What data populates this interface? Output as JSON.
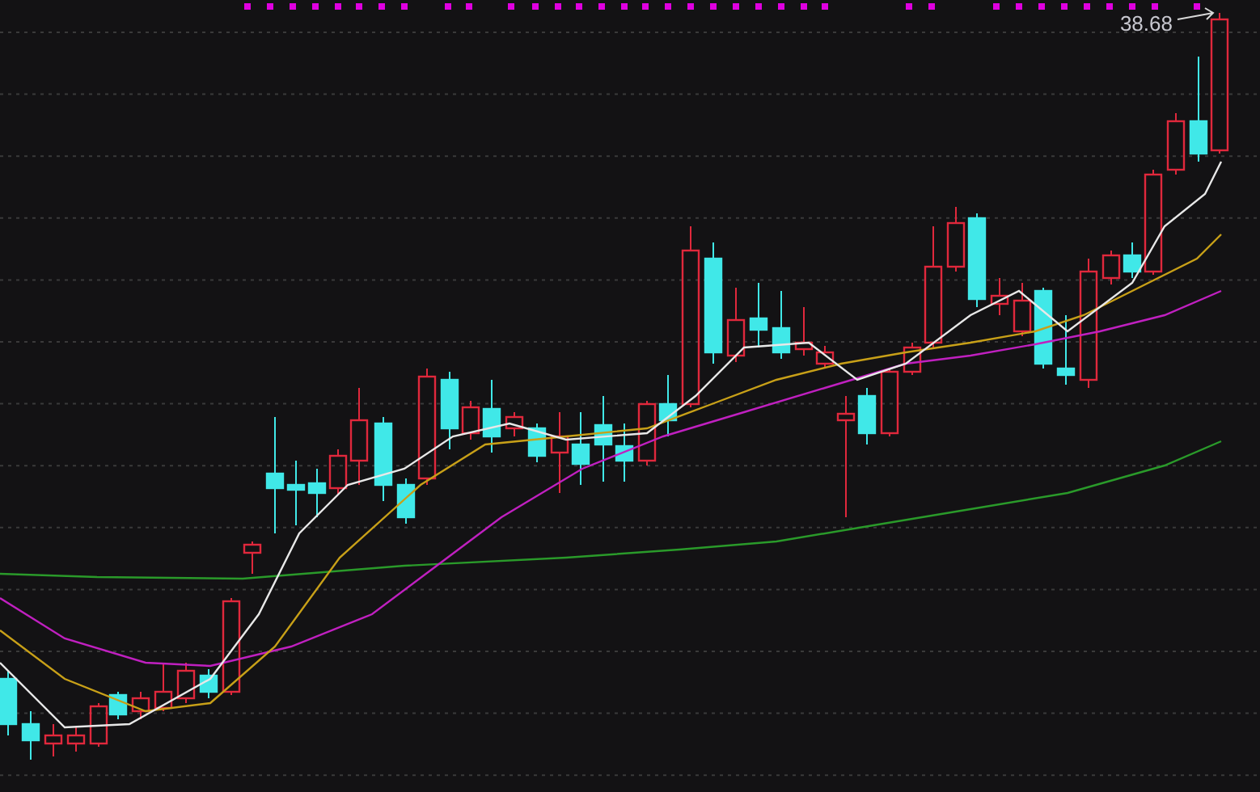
{
  "chart": {
    "high_label": "38.68"
  }
}
